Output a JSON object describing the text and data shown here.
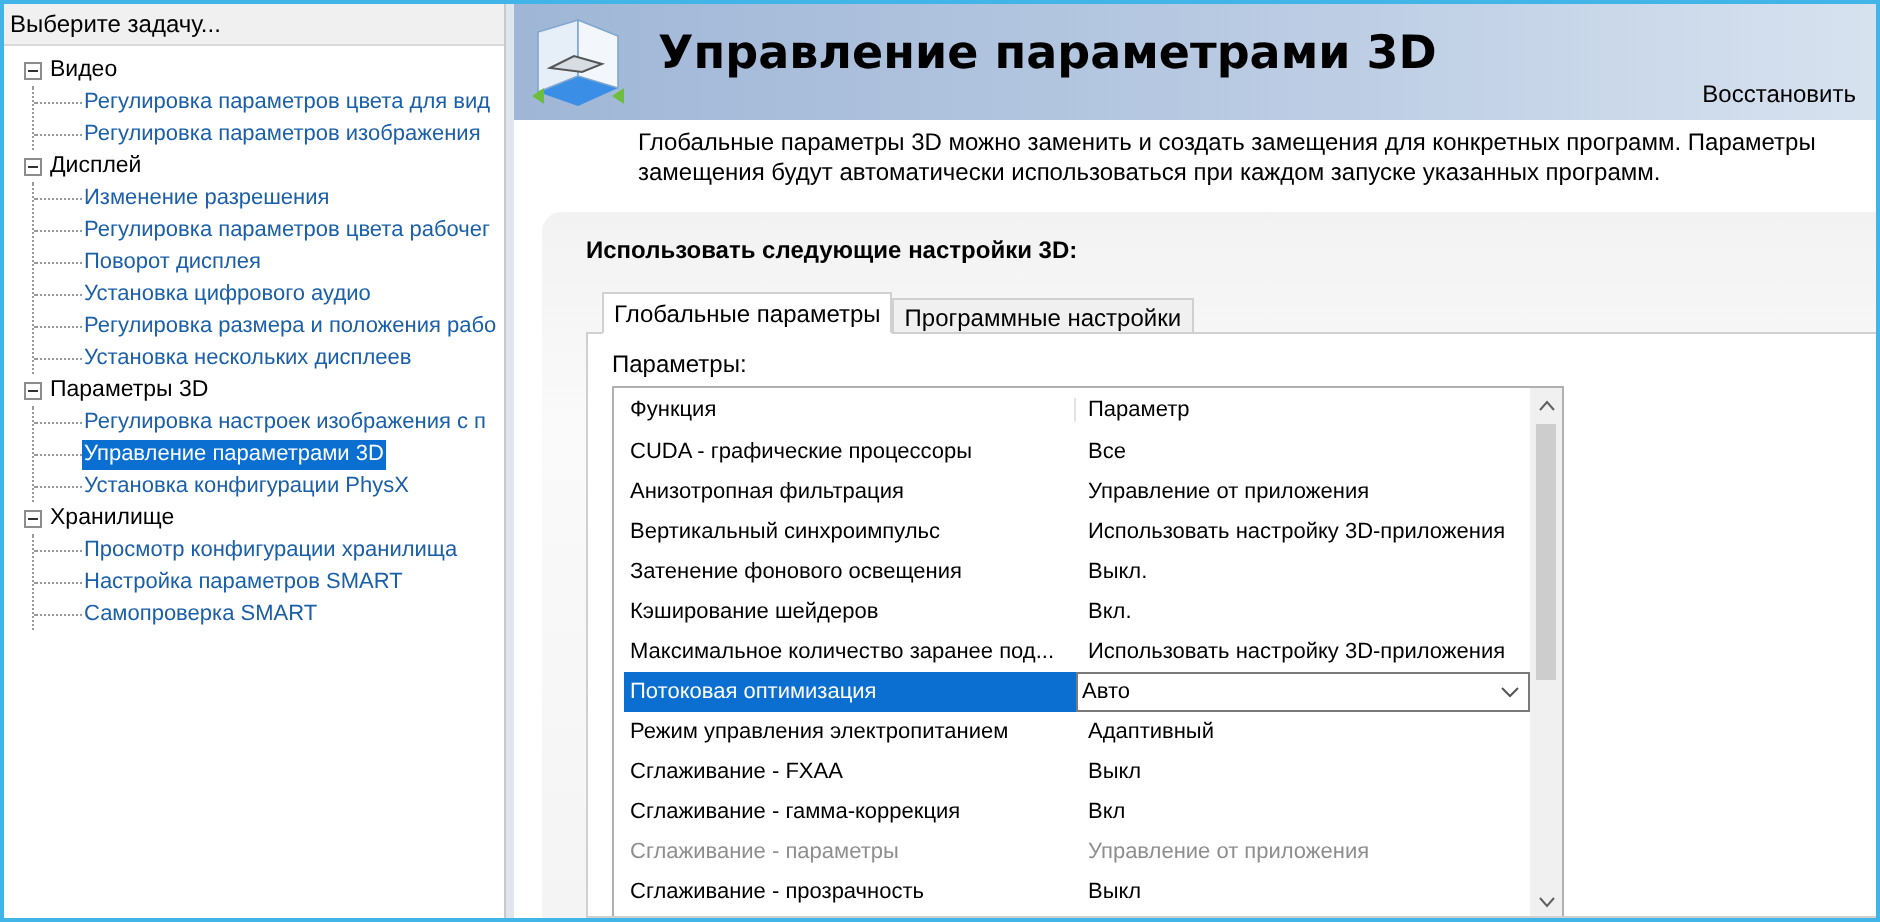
{
  "sidebar": {
    "title": "Выберите задачу...",
    "groups": [
      {
        "label": "Видео",
        "expanded": true,
        "children": [
          {
            "label": "Регулировка параметров цвета для вид",
            "selected": false
          },
          {
            "label": "Регулировка параметров изображения",
            "selected": false
          }
        ]
      },
      {
        "label": "Дисплей",
        "expanded": true,
        "children": [
          {
            "label": "Изменение разрешения",
            "selected": false
          },
          {
            "label": "Регулировка параметров цвета рабочег",
            "selected": false
          },
          {
            "label": "Поворот дисплея",
            "selected": false
          },
          {
            "label": "Установка цифрового аудио",
            "selected": false
          },
          {
            "label": "Регулировка размера и положения рабо",
            "selected": false
          },
          {
            "label": "Установка нескольких дисплеев",
            "selected": false
          }
        ]
      },
      {
        "label": "Параметры 3D",
        "expanded": true,
        "children": [
          {
            "label": "Регулировка настроек изображения с п",
            "selected": false
          },
          {
            "label": "Управление параметрами 3D",
            "selected": true
          },
          {
            "label": "Установка конфигурации PhysX",
            "selected": false
          }
        ]
      },
      {
        "label": "Хранилище",
        "expanded": true,
        "children": [
          {
            "label": "Просмотр конфигурации хранилища",
            "selected": false
          },
          {
            "label": "Настройка параметров SMART",
            "selected": false
          },
          {
            "label": "Самопроверка SMART",
            "selected": false
          }
        ]
      }
    ]
  },
  "header": {
    "title": "Управление параметрами 3D",
    "restore_link": "Восстановить"
  },
  "description": "Глобальные параметры 3D можно заменить и создать замещения для конкретных программ. Параметры замещения будут автоматически использоваться при каждом запуске указанных программ.",
  "settings": {
    "heading": "Использовать следующие настройки 3D:",
    "tabs": [
      {
        "label": "Глобальные параметры",
        "selected": true
      },
      {
        "label": "Программные настройки",
        "selected": false
      }
    ],
    "table_label": "Параметры:",
    "columns": [
      "Функция",
      "Параметр"
    ],
    "rows": [
      {
        "function": "CUDA - графические процессоры",
        "value": "Все",
        "selected": false,
        "disabled": false
      },
      {
        "function": "Анизотропная фильтрация",
        "value": "Управление от приложения",
        "selected": false,
        "disabled": false
      },
      {
        "function": "Вертикальный синхроимпульс",
        "value": "Использовать настройку 3D-приложения",
        "selected": false,
        "disabled": false
      },
      {
        "function": "Затенение фонового освещения",
        "value": "Выкл.",
        "selected": false,
        "disabled": false
      },
      {
        "function": "Кэширование шейдеров",
        "value": "Вкл.",
        "selected": false,
        "disabled": false
      },
      {
        "function": "Максимальное количество заранее под...",
        "value": "Использовать настройку 3D-приложения",
        "selected": false,
        "disabled": false
      },
      {
        "function": "Потоковая оптимизация",
        "value": "Авто",
        "selected": true,
        "disabled": false
      },
      {
        "function": "Режим управления электропитанием",
        "value": "Адаптивный",
        "selected": false,
        "disabled": false
      },
      {
        "function": "Сглаживание - FXAA",
        "value": "Выкл",
        "selected": false,
        "disabled": false
      },
      {
        "function": "Сглаживание - гамма-коррекция",
        "value": "Вкл",
        "selected": false,
        "disabled": false
      },
      {
        "function": "Сглаживание - параметры",
        "value": "Управление от приложения",
        "selected": false,
        "disabled": true
      },
      {
        "function": "Сглаживание - прозрачность",
        "value": "Выкл",
        "selected": false,
        "disabled": false
      }
    ]
  }
}
